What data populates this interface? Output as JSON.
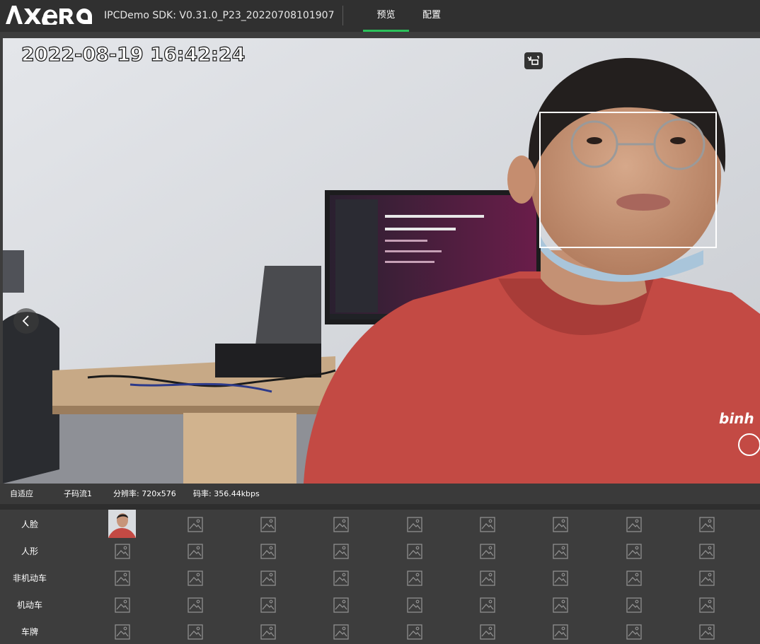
{
  "header": {
    "logo_text": "AXERA",
    "sdk_version": "IPCDemo SDK: V0.31.0_P23_20220708101907",
    "tabs": [
      {
        "label": "预览",
        "active": true
      },
      {
        "label": "配置",
        "active": false
      }
    ],
    "accent_color": "#2bc25a"
  },
  "video": {
    "osd_timestamp": "2022-08-19 16:42:24"
  },
  "status_bar": {
    "scale_mode": "自适应",
    "stream": "子码流1",
    "resolution": "分辨率: 720x576",
    "bitrate": "码率: 356.44kbps"
  },
  "capture_grid": {
    "rows": [
      {
        "label": "人脸",
        "has_capture_first": true
      },
      {
        "label": "人形",
        "has_capture_first": false
      },
      {
        "label": "非机动车",
        "has_capture_first": false
      },
      {
        "label": "机动车",
        "has_capture_first": false
      },
      {
        "label": "车牌",
        "has_capture_first": false
      }
    ],
    "placeholder_icon": "image-placeholder-icon"
  }
}
